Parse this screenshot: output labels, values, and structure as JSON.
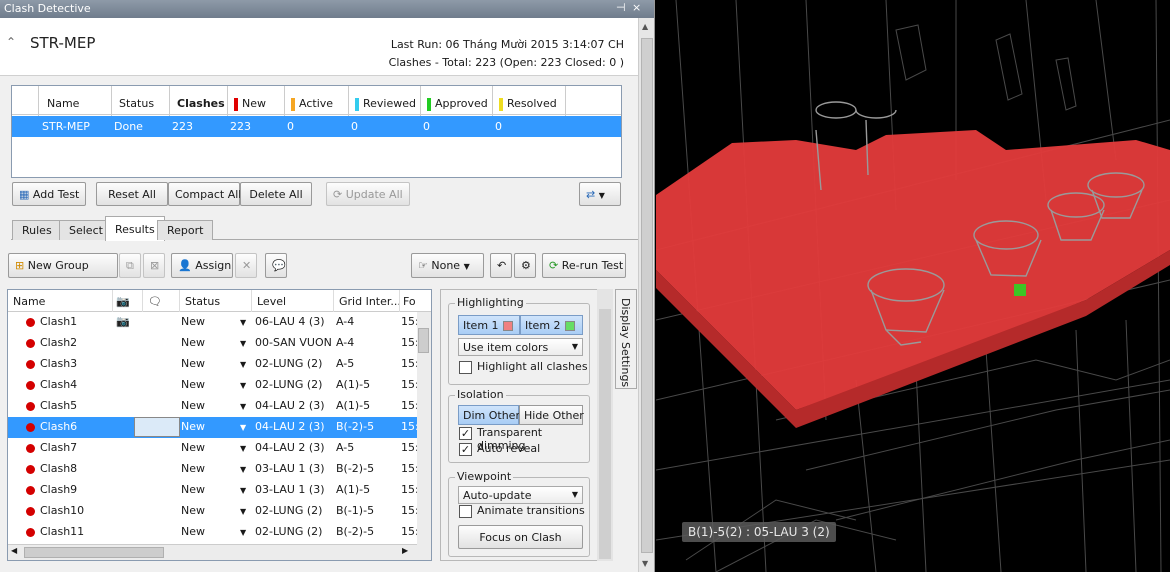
{
  "window": {
    "title": "Clash Detective"
  },
  "header": {
    "test_name": "STR-MEP",
    "last_run_label": "Last Run:",
    "last_run_value": "06 Tháng Mười 2015 3:14:07 CH",
    "summary": "Clashes - Total: 223 (Open: 223 Closed: 0 )"
  },
  "tests_grid": {
    "columns": [
      "Name",
      "Status",
      "Clashes",
      "New",
      "Active",
      "Reviewed",
      "Approved",
      "Resolved"
    ],
    "column_colors": {
      "New": "#e00000",
      "Active": "#f5a623",
      "Reviewed": "#33ccee",
      "Approved": "#22cc22",
      "Resolved": "#eedd22"
    },
    "rows": [
      {
        "name": "STR-MEP",
        "status": "Done",
        "clashes": "223",
        "new": "223",
        "active": "0",
        "reviewed": "0",
        "approved": "0",
        "resolved": "0"
      }
    ]
  },
  "toolbar1": {
    "add_test": "Add Test",
    "reset_all": "Reset All",
    "compact_all": "Compact All",
    "delete_all": "Delete All",
    "update_all": "Update All"
  },
  "tabs": [
    "Rules",
    "Select",
    "Results",
    "Report"
  ],
  "active_tab": "Results",
  "toolbar2": {
    "new_group": "New Group",
    "assign": "Assign",
    "none": "None",
    "rerun": "Re-run Test"
  },
  "results": {
    "columns": [
      "Name",
      "Status",
      "Level",
      "Grid Inter...",
      "Fo"
    ],
    "rows": [
      {
        "name": "Clash1",
        "status": "New",
        "level": "06-LAU 4 (3)",
        "grid": "A-4",
        "fo": "15:"
      },
      {
        "name": "Clash2",
        "status": "New",
        "level": "00-SAN VUON",
        "grid": "A-4",
        "fo": "15:"
      },
      {
        "name": "Clash3",
        "status": "New",
        "level": "02-LUNG (2)",
        "grid": "A-5",
        "fo": "15:"
      },
      {
        "name": "Clash4",
        "status": "New",
        "level": "02-LUNG (2)",
        "grid": "A(1)-5",
        "fo": "15:"
      },
      {
        "name": "Clash5",
        "status": "New",
        "level": "04-LAU 2 (3)",
        "grid": "A(1)-5",
        "fo": "15:"
      },
      {
        "name": "Clash6",
        "status": "New",
        "level": "04-LAU 2 (3)",
        "grid": "B(-2)-5",
        "fo": "15:"
      },
      {
        "name": "Clash7",
        "status": "New",
        "level": "04-LAU 2 (3)",
        "grid": "A-5",
        "fo": "15:"
      },
      {
        "name": "Clash8",
        "status": "New",
        "level": "03-LAU 1 (3)",
        "grid": "B(-2)-5",
        "fo": "15:"
      },
      {
        "name": "Clash9",
        "status": "New",
        "level": "03-LAU 1 (3)",
        "grid": "A(1)-5",
        "fo": "15:"
      },
      {
        "name": "Clash10",
        "status": "New",
        "level": "02-LUNG (2)",
        "grid": "B(-1)-5",
        "fo": "15:"
      },
      {
        "name": "Clash11",
        "status": "New",
        "level": "02-LUNG (2)",
        "grid": "B(-2)-5",
        "fo": "15:"
      }
    ],
    "selected": "Clash6"
  },
  "display_settings": {
    "tab_label": "Display Settings",
    "highlighting": {
      "label": "Highlighting",
      "item1": "Item 1",
      "item2": "Item 2",
      "item1_color": "#f08080",
      "item2_color": "#66dd66",
      "mode": "Use item colors",
      "highlight_all": "Highlight all clashes"
    },
    "isolation": {
      "label": "Isolation",
      "dim_other": "Dim Other",
      "hide_other": "Hide Other",
      "transparent": "Transparent dimming",
      "auto_reveal": "Auto reveal"
    },
    "viewpoint": {
      "label": "Viewpoint",
      "mode": "Auto-update",
      "animate": "Animate transitions",
      "focus": "Focus on Clash"
    }
  },
  "viewport": {
    "location_label": "B(1)-5(2) : 05-LAU 3 (2)",
    "clash_color": "#e43b3b"
  }
}
